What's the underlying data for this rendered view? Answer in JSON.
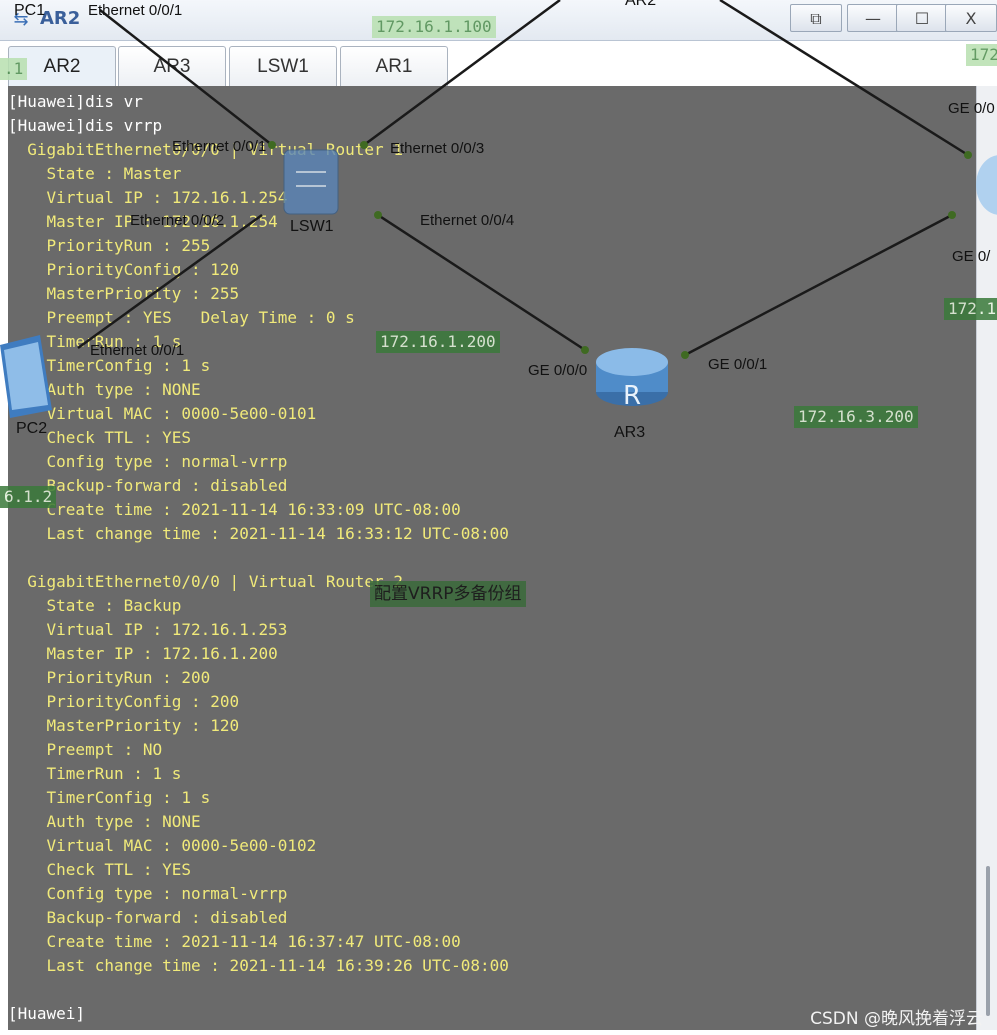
{
  "window": {
    "title": "AR2",
    "buttons": {
      "restore": "⧉",
      "minimize": "—",
      "maximize": "☐",
      "close": "X"
    }
  },
  "tabs": [
    {
      "label": "AR2",
      "active": true
    },
    {
      "label": "AR3",
      "active": false
    },
    {
      "label": "LSW1",
      "active": false
    },
    {
      "label": "AR1",
      "active": false
    }
  ],
  "terminal": {
    "lines": [
      "[Huawei]dis vr",
      "[Huawei]dis vrrp",
      "  GigabitEthernet0/0/0 | Virtual Router 1",
      "    State : Master",
      "    Virtual IP : 172.16.1.254",
      "    Master IP : 172.16.1.254",
      "    PriorityRun : 255",
      "    PriorityConfig : 120",
      "    MasterPriority : 255",
      "    Preempt : YES   Delay Time : 0 s",
      "    TimerRun : 1 s",
      "    TimerConfig : 1 s",
      "    Auth type : NONE",
      "    Virtual MAC : 0000-5e00-0101",
      "    Check TTL : YES",
      "    Config type : normal-vrrp",
      "    Backup-forward : disabled",
      "    Create time : 2021-11-14 16:33:09 UTC-08:00",
      "    Last change time : 2021-11-14 16:33:12 UTC-08:00",
      "",
      "  GigabitEthernet0/0/0 | Virtual Router 2",
      "    State : Backup",
      "    Virtual IP : 172.16.1.253",
      "    Master IP : 172.16.1.200",
      "    PriorityRun : 200",
      "    PriorityConfig : 200",
      "    MasterPriority : 120",
      "    Preempt : NO",
      "    TimerRun : 1 s",
      "    TimerConfig : 1 s",
      "    Auth type : NONE",
      "    Virtual MAC : 0000-5e00-0102",
      "    Check TTL : YES",
      "    Config type : normal-vrrp",
      "    Backup-forward : disabled",
      "    Create time : 2021-11-14 16:37:47 UTC-08:00",
      "    Last change time : 2021-11-14 16:39:26 UTC-08:00",
      "",
      "[Huawei]"
    ]
  },
  "topology": {
    "labels": {
      "pc1": "PC1",
      "pc1_port": "Ethernet 0/0/1",
      "ar2_top": "AR2",
      "lsw1": "LSW1",
      "lsw1_e1": "Ethernet 0/0/1",
      "lsw1_e3": "Ethernet 0/0/3",
      "lsw1_e2": "Ethernet 0/0/2",
      "lsw1_e4": "Ethernet 0/0/4",
      "pc2_port": "Ethernet 0/0/1",
      "pc2": "PC2",
      "ar3": "AR3",
      "ar3_ge0": "GE 0/0/0",
      "ar3_ge1": "GE 0/0/1",
      "right_ge_top": "GE 0/0",
      "right_ge_bottom": "GE 0/"
    },
    "ip_tags": {
      "top": "172.16.1.100",
      "right_top": "172",
      "left_partial": ".1",
      "ar3_ip": "172.16.1.200",
      "right_mid": "172.1",
      "ar3_right": "172.16.3.200",
      "pc2_ip": "6.1.2"
    },
    "caption": "配置VRRP多备份组"
  },
  "watermark": "CSDN @晚风挽着浮云"
}
